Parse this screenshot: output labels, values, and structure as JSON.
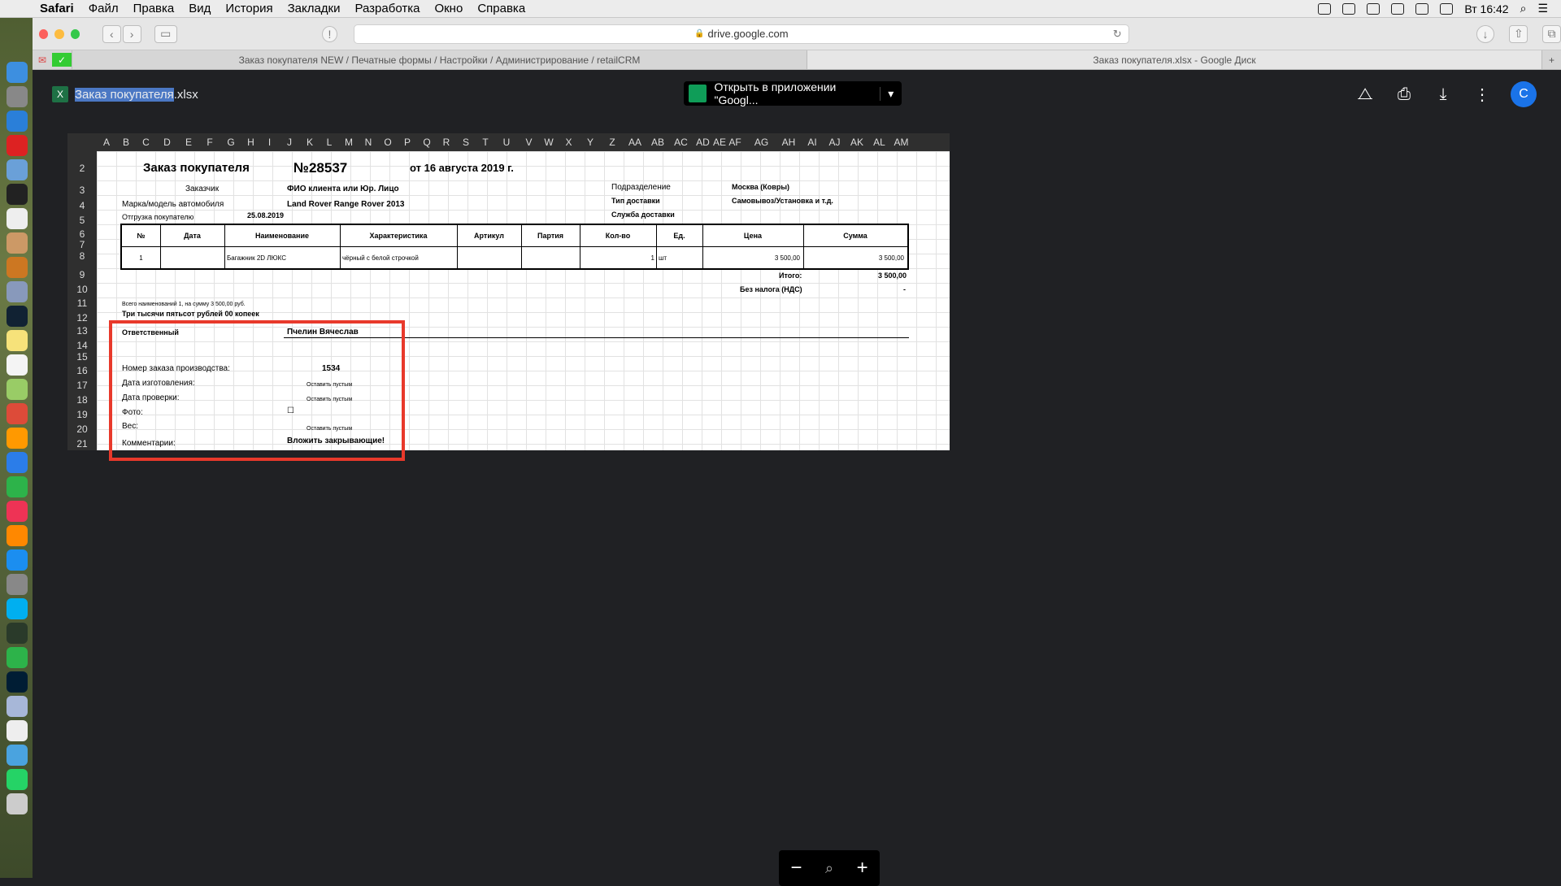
{
  "menubar": {
    "app": "Safari",
    "items": [
      "Файл",
      "Правка",
      "Вид",
      "История",
      "Закладки",
      "Разработка",
      "Окно",
      "Справка"
    ],
    "clock": "Вт 16:42"
  },
  "browser": {
    "url": "drive.google.com",
    "tabs": [
      "Заказ покупателя NEW / Печатные формы / Настройки / Администрирование / retailCRM",
      "Заказ покупателя.xlsx - Google Диск"
    ]
  },
  "viewer": {
    "file_icon": "X",
    "file_name_selected": "Заказ покупателя",
    "file_name_rest": ".xlsx",
    "open_button": "Открыть в приложении \"Googl...",
    "avatar": "C"
  },
  "sheet": {
    "columns": [
      "A",
      "B",
      "C",
      "D",
      "E",
      "F",
      "G",
      "H",
      "I",
      "J",
      "K",
      "L",
      "M",
      "N",
      "O",
      "P",
      "Q",
      "R",
      "S",
      "T",
      "U",
      "V",
      "W",
      "X",
      "Y",
      "Z",
      "AA",
      "AB",
      "AC",
      "AD",
      "AE",
      "AF",
      "AG",
      "AH",
      "AI",
      "AJ",
      "AK",
      "AL",
      "AM"
    ],
    "rows": [
      "2",
      "3",
      "4",
      "5",
      "6",
      "7",
      "8",
      "9",
      "10",
      "11",
      "12",
      "13",
      "14",
      "15",
      "16",
      "17",
      "18",
      "19",
      "20",
      "21"
    ],
    "title": "Заказ покупателя",
    "number": "№28537",
    "date": "от 16 августа 2019 г.",
    "customer_label": "Заказчик",
    "customer_value": "ФИО клиента или Юр. Лицо",
    "car_label": "Марка/модель автомобиля",
    "car_value": "Land Rover Range Rover 2013",
    "ship_label": "Отгрузка покупателю",
    "ship_value": "25.08.2019",
    "dept_label": "Подразделение",
    "dept_value": "Москва (Ковры)",
    "delivery_label": "Тип доставки",
    "delivery_value": "Самовывоз/Установка и т.д.",
    "service_label": "Служба доставки",
    "table_headers": [
      "№",
      "Дата",
      "Наименование",
      "Характеристика",
      "Артикул",
      "Партия",
      "Кол-во",
      "Ед.",
      "Цена",
      "Сумма"
    ],
    "table_row": [
      "1",
      "",
      "Багажник 2D ЛЮКС",
      "чёрный с белой строчкой",
      "",
      "",
      "1",
      "шт",
      "3 500,00",
      "3 500,00"
    ],
    "total_label": "Итого:",
    "total_value": "3 500,00",
    "vat_label": "Без налога (НДС)",
    "vat_value": "-",
    "summary_small": "Всего наименований 1, на сумму 3 500,00 руб.",
    "summary_words": "Три тысячи пятьсот рублей 00 копеек",
    "responsible_label": "Ответственный",
    "responsible_value": "Пчелин Вячеслав",
    "prod_label": "Номер заказа производства:",
    "prod_value": "1534",
    "made_label": "Дата изготовления:",
    "made_value": "Оставить пустым",
    "check_label": "Дата проверки:",
    "check_value": "Оставить пустым",
    "photo_label": "Фото:",
    "photo_value": "☐",
    "weight_label": "Вес:",
    "weight_value": "Оставить пустым",
    "comment_label": "Комментарии:",
    "comment_value": "Вложить закрывающие!"
  },
  "colors": {
    "highlight": "#e8392b",
    "sheets_green": "#0f9d58",
    "avatar": "#1a73e8"
  }
}
